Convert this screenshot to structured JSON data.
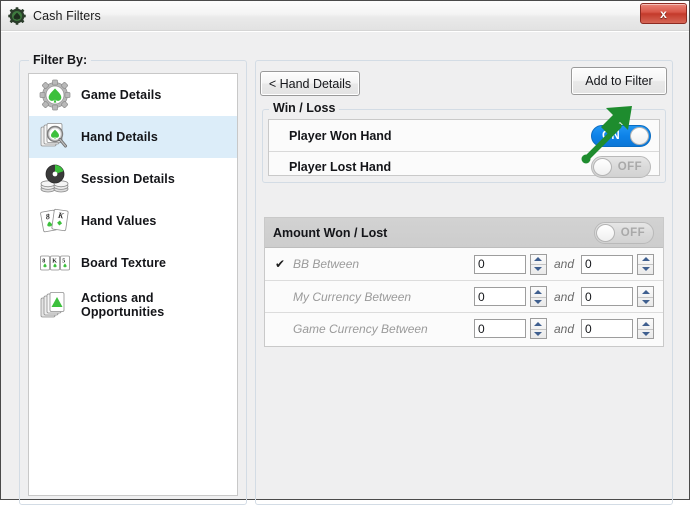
{
  "window": {
    "title": "Cash Filters",
    "icon": "gear-spade-icon",
    "close_label": "x"
  },
  "sidebar": {
    "group_title": "Filter By:",
    "items": [
      {
        "label": "Game Details",
        "icon": "gear-spade-icon",
        "selected": false
      },
      {
        "label": "Hand Details",
        "icon": "cards-magnifier-icon",
        "selected": true
      },
      {
        "label": "Session Details",
        "icon": "chips-piechart-icon",
        "selected": false
      },
      {
        "label": "Hand Values",
        "icon": "two-cards-icon",
        "selected": false
      },
      {
        "label": "Board Texture",
        "icon": "three-cards-icon",
        "selected": false
      },
      {
        "label": "Actions and Opportunities",
        "icon": "card-stack-arrow-icon",
        "selected": false
      }
    ]
  },
  "main": {
    "back_button": "< Hand Details",
    "add_filter_button": "Add to Filter",
    "winloss": {
      "group_title": "Win / Loss",
      "rows": [
        {
          "label": "Player Won Hand",
          "toggle": "ON",
          "state": "on"
        },
        {
          "label": "Player Lost Hand",
          "toggle": "OFF",
          "state": "off"
        }
      ]
    },
    "amount": {
      "header_title": "Amount Won / Lost",
      "header_toggle": "OFF",
      "header_toggle_state": "off",
      "and_word": "and",
      "check_glyph": "✔",
      "rows": [
        {
          "label": "BB Between",
          "checked": true,
          "from": "0",
          "to": "0"
        },
        {
          "label": "My Currency Between",
          "checked": false,
          "from": "0",
          "to": "0"
        },
        {
          "label": "Game Currency Between",
          "checked": false,
          "from": "0",
          "to": "0"
        }
      ]
    }
  },
  "annotation": {
    "type": "green-arrow",
    "color": "#1e8c2e",
    "points_to": "Add to Filter"
  },
  "colors": {
    "accent_blue": "#0d82e8",
    "selection": "#dcedf9",
    "annotation_green": "#1e8c2e",
    "close_red": "#c43a2b"
  }
}
